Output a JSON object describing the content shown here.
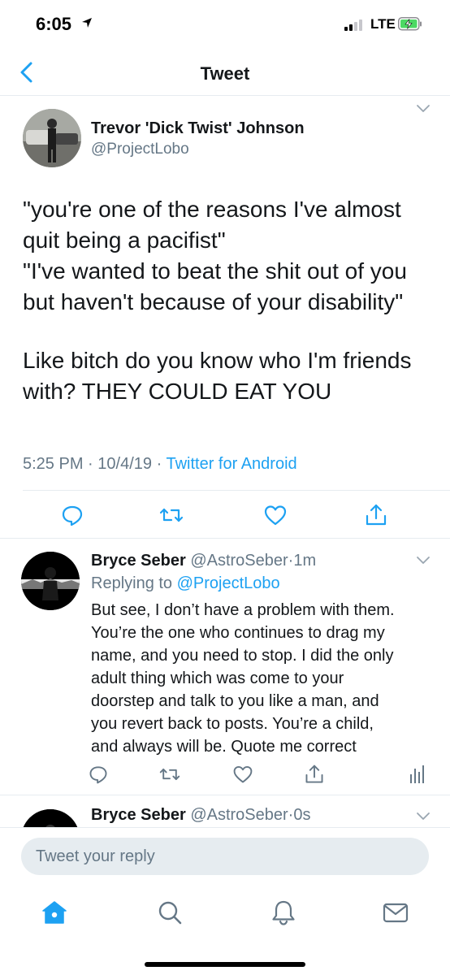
{
  "status_bar": {
    "time": "6:05",
    "network": "LTE"
  },
  "nav": {
    "title": "Tweet"
  },
  "main_tweet": {
    "author_name": "Trevor 'Dick Twist' Johnson",
    "author_handle": "@ProjectLobo",
    "text_lines": [
      "\"you're one of the reasons I've almost",
      "quit being a pacifist\"",
      "\"I've wanted to beat the shit out of you",
      "but haven't because of your disability\""
    ],
    "text2_lines": [
      "Like bitch do you know who I'm friends",
      "with? THEY COULD EAT YOU"
    ],
    "time": "5:25 PM",
    "date": "10/4/19",
    "source": "Twitter for Android",
    "separator": "·"
  },
  "replies": [
    {
      "name": "Bryce Seber",
      "handle": "@AstroSeber",
      "age": "1m",
      "replying_prefix": "Replying to",
      "replying_to": "@ProjectLobo",
      "text_lines": [
        "But see, I don’t have a problem with them.",
        "You’re the one who continues to drag my",
        "name, and you need to stop. I did the only",
        "adult thing which was come to your",
        "doorstep and talk to you like a man, and",
        "you revert back to posts. You’re a child,",
        "and always will be. Quote me correct"
      ]
    },
    {
      "name": "Bryce Seber",
      "handle": "@AstroSeber",
      "age": "0s"
    }
  ],
  "composer": {
    "placeholder": "Tweet your reply"
  },
  "icons": {
    "back": "chevron-left-icon",
    "reply": "speech-bubble-icon",
    "retweet": "retweet-icon",
    "like": "heart-icon",
    "share": "share-icon",
    "analytics": "bar-chart-icon",
    "home": "home-icon",
    "search": "search-icon",
    "notifications": "bell-icon",
    "messages": "envelope-icon"
  },
  "colors": {
    "accent": "#1da1f2",
    "secondary_text": "#657786",
    "divider": "#e6ecf0",
    "battery": "#4cd964"
  }
}
